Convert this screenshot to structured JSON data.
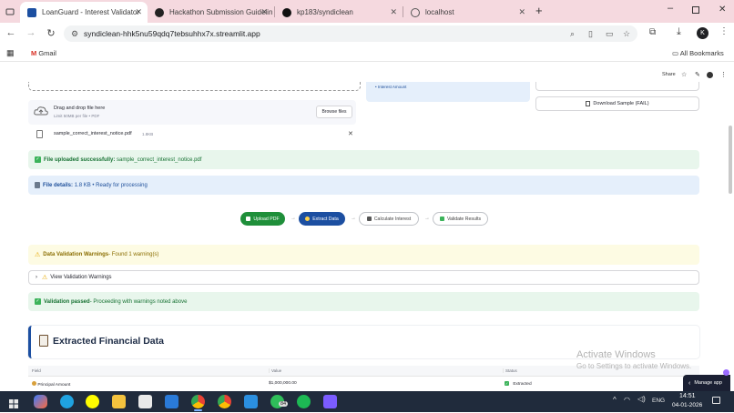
{
  "browser": {
    "tabs": [
      {
        "title": "LoanGuard - Interest Validator",
        "active": true,
        "icon": "loanguard-icon"
      },
      {
        "title": "Hackathon Submission Guidelin",
        "active": false,
        "icon": "devpost-icon"
      },
      {
        "title": "kp183/syndiclean",
        "active": false,
        "icon": "github-icon"
      },
      {
        "title": "localhost",
        "active": false,
        "icon": "globe-icon"
      }
    ],
    "url": "syndiclean-hhk5nu59qdq7tebsuhhx7x.streamlit.app",
    "profile_initial": "K",
    "bookmarks": {
      "gmail": "Gmail",
      "all": "All Bookmarks"
    }
  },
  "app": {
    "share_label": "Share",
    "info_item": "Interest Amount",
    "uploader": {
      "title": "Drag and drop file here",
      "limit": "Limit 50MB per file • PDF",
      "browse_label": "Browse files",
      "file_name": "sample_correct_interest_notice.pdf",
      "file_size": "1.8KB"
    },
    "download_label": "Download Sample (FAIL)",
    "upload_success": {
      "bold": "File uploaded successfully:",
      "text": "sample_correct_interest_notice.pdf"
    },
    "file_details": {
      "bold": "File details:",
      "text": "1.8 KB • Ready for processing"
    },
    "steps": [
      {
        "label": "Upload PDF",
        "state": "done"
      },
      {
        "label": "Extract Data",
        "state": "current"
      },
      {
        "label": "Calculate Interest",
        "state": "pending"
      },
      {
        "label": "Validate Results",
        "state": "pending"
      }
    ],
    "warning": {
      "bold": "Data Validation Warnings",
      "text": " - Found 1 warning(s)"
    },
    "expander_label": "View Validation Warnings",
    "validation": {
      "bold": "Validation passed",
      "text": " - Proceeding with warnings noted above"
    },
    "section_title": "Extracted Financial Data",
    "table": {
      "headers": [
        "Field",
        "Value",
        "Status"
      ],
      "rows": [
        {
          "field": "Principal Amount",
          "value": "$1,000,000.00",
          "status": "Extracted"
        }
      ]
    },
    "manage_app": "Manage app"
  },
  "watermark": {
    "title": "Activate Windows",
    "subtitle": "Go to Settings to activate Windows."
  },
  "taskbar": {
    "language": "ENG",
    "time": "14:51",
    "date": "04-01-2026",
    "badge": "84"
  },
  "colors": {
    "accent_red": "#ff4b4b",
    "success_green": "#177233",
    "info_blue": "#1e4f9a",
    "step_blue": "#1c4fa1",
    "step_green": "#1f8f3a"
  }
}
